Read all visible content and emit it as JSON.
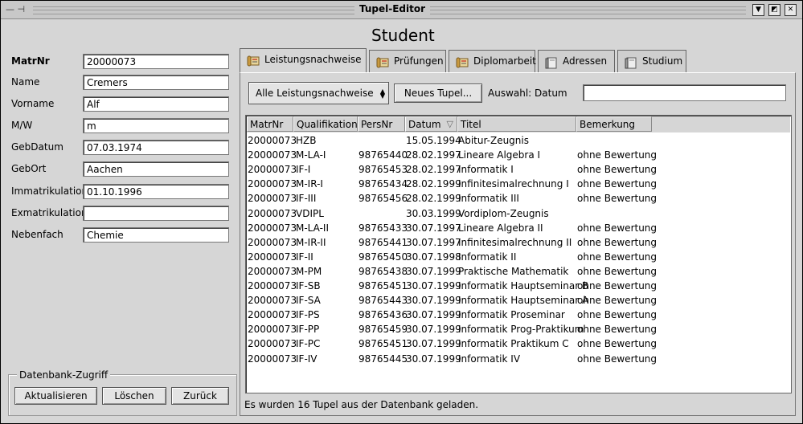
{
  "window": {
    "title": "Tupel-Editor",
    "heading": "Student"
  },
  "form": {
    "fields": [
      {
        "label": "MatrNr",
        "value": "20000073"
      },
      {
        "label": "Name",
        "value": "Cremers"
      },
      {
        "label": "Vorname",
        "value": "Alf"
      },
      {
        "label": "M/W",
        "value": "m"
      },
      {
        "label": "GebDatum",
        "value": "07.03.1974"
      },
      {
        "label": "GebOrt",
        "value": "Aachen"
      },
      {
        "label": "Immatrikulation",
        "value": "01.10.1996"
      },
      {
        "label": "Exmatrikulation",
        "value": ""
      },
      {
        "label": "Nebenfach",
        "value": "Chemie"
      }
    ]
  },
  "db_group": {
    "title": "Datenbank-Zugriff",
    "refresh": "Aktualisieren",
    "delete": "Löschen",
    "back": "Zurück"
  },
  "tabs": [
    {
      "label": "Leistungsnachweise",
      "icon": "scroll-icon"
    },
    {
      "label": "Prüfungen",
      "icon": "scroll-icon"
    },
    {
      "label": "Diplomarbeit",
      "icon": "scroll-icon"
    },
    {
      "label": "Adressen",
      "icon": "book-icon"
    },
    {
      "label": "Studium",
      "icon": "book-icon"
    }
  ],
  "toolbar": {
    "filter_value": "Alle Leistungsnachweise",
    "new_tuple": "Neues Tupel...",
    "selection_label": "Auswahl: Datum",
    "selection_value": ""
  },
  "table": {
    "columns": [
      "MatrNr",
      "Qualifikation",
      "PersNr",
      "Datum",
      "Titel",
      "Bemerkung"
    ],
    "rows": [
      [
        "20000073",
        "HZB",
        "",
        "15.05.1994",
        "Abitur-Zeugnis",
        ""
      ],
      [
        "20000073",
        "M-LA-I",
        "98765440",
        "28.02.1997",
        "Lineare Algebra I",
        "ohne Bewertung"
      ],
      [
        "20000073",
        "IF-I",
        "98765453",
        "28.02.1997",
        "Informatik I",
        "ohne Bewertung"
      ],
      [
        "20000073",
        "M-IR-I",
        "98765434",
        "28.02.1999",
        "Infinitesimalrechnung I",
        "ohne Bewertung"
      ],
      [
        "20000073",
        "IF-III",
        "98765456",
        "28.02.1999",
        "Informatik III",
        "ohne Bewertung"
      ],
      [
        "20000073",
        "VDIPL",
        "",
        "30.03.1999",
        "Vordiplom-Zeugnis",
        ""
      ],
      [
        "20000073",
        "M-LA-II",
        "98765433",
        "30.07.1997",
        "Lineare Algebra II",
        "ohne Bewertung"
      ],
      [
        "20000073",
        "M-IR-II",
        "98765441",
        "30.07.1997",
        "Infinitesimalrechnung II",
        "ohne Bewertung"
      ],
      [
        "20000073",
        "IF-II",
        "98765450",
        "30.07.1998",
        "Informatik II",
        "ohne Bewertung"
      ],
      [
        "20000073",
        "M-PM",
        "98765438",
        "30.07.1999",
        "Praktische Mathematik",
        "ohne Bewertung"
      ],
      [
        "20000073",
        "IF-SB",
        "98765451",
        "30.07.1999",
        "Informatik Hauptseminar B",
        "ohne Bewertung"
      ],
      [
        "20000073",
        "IF-SA",
        "98765443",
        "30.07.1999",
        "Informatik Hauptseminar A",
        "ohne Bewertung"
      ],
      [
        "20000073",
        "IF-PS",
        "98765436",
        "30.07.1999",
        "Informatik Proseminar",
        "ohne Bewertung"
      ],
      [
        "20000073",
        "IF-PP",
        "98765459",
        "30.07.1999",
        "Informatik Prog-Praktikum",
        "ohne Bewertung"
      ],
      [
        "20000073",
        "IF-PC",
        "98765451",
        "30.07.1999",
        "Informatik Praktikum C",
        "ohne Bewertung"
      ],
      [
        "20000073",
        "IF-IV",
        "98765445",
        "30.07.1999",
        "Informatik IV",
        "ohne Bewertung"
      ]
    ]
  },
  "status": "Es wurden 16 Tupel aus der Datenbank geladen."
}
